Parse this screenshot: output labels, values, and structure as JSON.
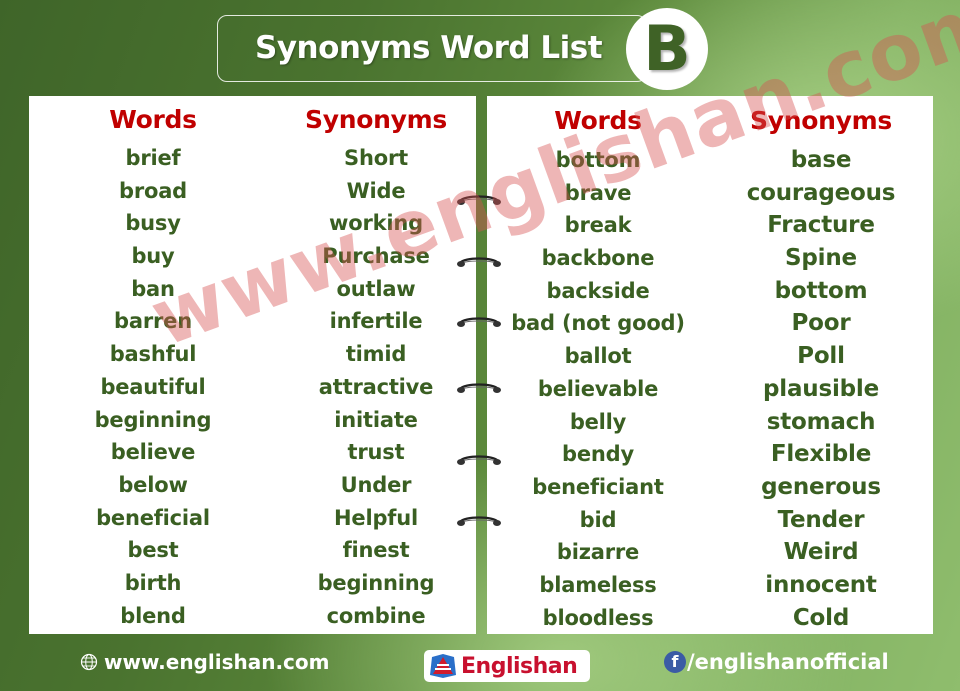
{
  "header": {
    "title": "Synonyms Word List",
    "letter": "B"
  },
  "colors": {
    "heading_red": "#c00000",
    "word_green": "#3a5f22",
    "badge_letter_green": "#3f6226",
    "watermark_pink": "#d75050",
    "logo_red": "#c8102e",
    "facebook_blue": "#3b5ba5"
  },
  "left_table": {
    "words_header": "Words",
    "synonyms_header": "Synonyms",
    "rows": [
      {
        "word": "brief",
        "synonym": "Short"
      },
      {
        "word": "broad",
        "synonym": "Wide"
      },
      {
        "word": "busy",
        "synonym": "working"
      },
      {
        "word": "buy",
        "synonym": "Purchase"
      },
      {
        "word": "ban",
        "synonym": "outlaw"
      },
      {
        "word": "barren",
        "synonym": "infertile"
      },
      {
        "word": "bashful",
        "synonym": "timid"
      },
      {
        "word": "beautiful",
        "synonym": "attractive"
      },
      {
        "word": "beginning",
        "synonym": "initiate"
      },
      {
        "word": "believe",
        "synonym": "trust"
      },
      {
        "word": "below",
        "synonym": "Under"
      },
      {
        "word": "beneficial",
        "synonym": "Helpful"
      },
      {
        "word": "best",
        "synonym": "finest"
      },
      {
        "word": "birth",
        "synonym": "beginning"
      },
      {
        "word": "blend",
        "synonym": "combine"
      }
    ]
  },
  "right_table": {
    "words_header": "Words",
    "synonyms_header": "Synonyms",
    "rows": [
      {
        "word": "bottom",
        "synonym": "base"
      },
      {
        "word": "brave",
        "synonym": "courageous"
      },
      {
        "word": "break",
        "synonym": "Fracture"
      },
      {
        "word": "backbone",
        "synonym": "Spine"
      },
      {
        "word": "backside",
        "synonym": "bottom"
      },
      {
        "word": "bad (not good)",
        "synonym": "Poor"
      },
      {
        "word": "ballot",
        "synonym": "Poll"
      },
      {
        "word": "believable",
        "synonym": "plausible"
      },
      {
        "word": "belly",
        "synonym": "stomach"
      },
      {
        "word": "bendy",
        "synonym": "Flexible"
      },
      {
        "word": "beneficiant",
        "synonym": "generous"
      },
      {
        "word": "bid",
        "synonym": "Tender"
      },
      {
        "word": "bizarre",
        "synonym": "Weird"
      },
      {
        "word": "blameless",
        "synonym": "innocent"
      },
      {
        "word": "bloodless",
        "synonym": "Cold"
      }
    ]
  },
  "watermark": "www.englishan.com",
  "footer": {
    "website": "www.englishan.com",
    "website_icon": "globe-icon",
    "logo_text": "Englishan",
    "logo_icon": "englishan-logo-icon",
    "social": "/englishanofficial",
    "social_icon": "facebook-icon",
    "facebook_glyph": "f"
  }
}
